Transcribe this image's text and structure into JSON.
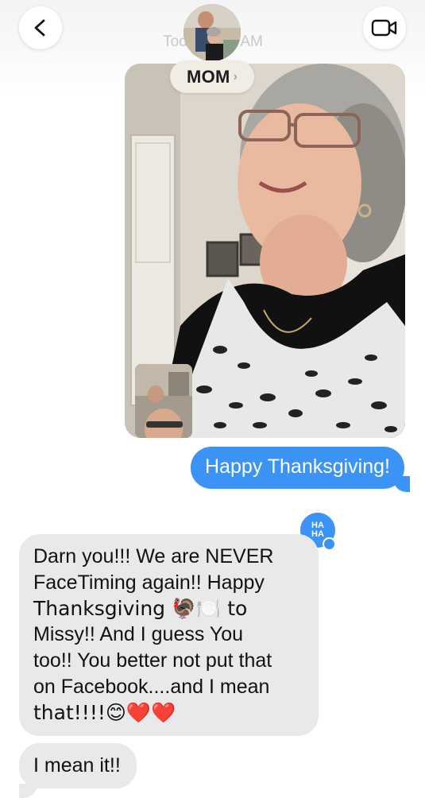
{
  "header": {
    "back_icon": "chevron-left-icon",
    "video_icon": "video-camera-icon",
    "timestamp": "Today 9:41 AM",
    "contact_name": "MOM",
    "contact_chevron": "›"
  },
  "messages": {
    "outgoing_text": "Happy Thanksgiving!",
    "tapback_label_top": "HA",
    "tapback_label_bottom": "HA",
    "incoming_lines": [
      "Darn you!!!  We are NEVER",
      "FaceTiming again!!  Happy",
      "Thanksgiving 🦃🍽️ to",
      "Missy!!  And I guess You",
      "too!!  You better not put that",
      "on Facebook....and I mean",
      "that!!!!😊❤️❤️"
    ],
    "incoming_text_2": "I mean it!!"
  },
  "colors": {
    "blue_bubble": "#3a93f5",
    "gray_bubble": "#e9e9eb",
    "heart": "#d21f2b"
  }
}
